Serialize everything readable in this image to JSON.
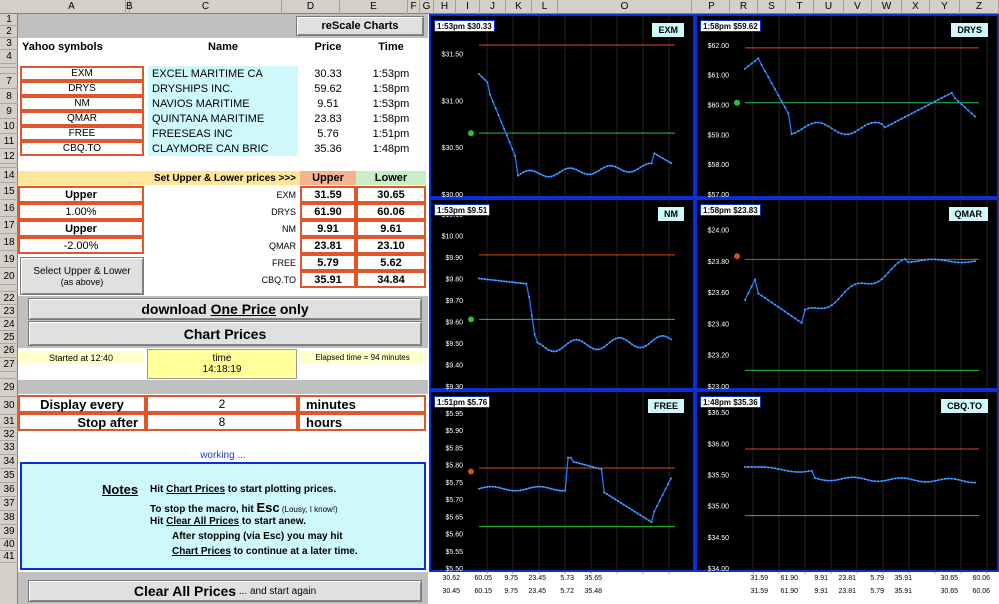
{
  "columns": [
    "A",
    "B",
    "C",
    "D",
    "E",
    "F",
    "G",
    "H",
    "I",
    "J",
    "K",
    "L",
    "O",
    "P",
    "R",
    "S",
    "T",
    "U",
    "V",
    "W",
    "X",
    "Y",
    "Z"
  ],
  "rows": [
    "1",
    "2",
    "3",
    "4",
    "5",
    "6",
    "7",
    "8",
    "9",
    "10",
    "11",
    "12",
    "13",
    "14",
    "15",
    "16",
    "17",
    "18",
    "19",
    "20",
    "21",
    "22",
    "23",
    "24",
    "25",
    "26",
    "27",
    "28",
    "29",
    "30",
    "31",
    "32",
    "33",
    "34",
    "35",
    "36",
    "37",
    "38",
    "39",
    "40",
    "41"
  ],
  "header": {
    "symbols": "Yahoo symbols",
    "name": "Name",
    "price": "Price",
    "time": "Time",
    "rescale": "reScale Charts"
  },
  "stocks": [
    {
      "sym": "EXM",
      "name": "EXCEL MARITIME CA",
      "price": "30.33",
      "time": "1:53pm"
    },
    {
      "sym": "DRYS",
      "name": "DRYSHIPS INC.",
      "price": "59.62",
      "time": "1:58pm"
    },
    {
      "sym": "NM",
      "name": "NAVIOS MARITIME",
      "price": "9.51",
      "time": "1:53pm"
    },
    {
      "sym": "QMAR",
      "name": "QUINTANA MARITIME",
      "price": "23.83",
      "time": "1:58pm"
    },
    {
      "sym": "FREE",
      "name": "FREESEAS INC",
      "price": "5.76",
      "time": "1:51pm"
    },
    {
      "sym": "CBQ.TO",
      "name": "CLAYMORE CAN BRIC",
      "price": "35.36",
      "time": "1:48pm"
    }
  ],
  "limits": {
    "title": "Set Upper & Lower prices >>>",
    "upper": "Upper",
    "lower": "Lower",
    "rows": [
      {
        "sym": "EXM",
        "upper": "31.59",
        "lower": "30.65"
      },
      {
        "sym": "DRYS",
        "upper": "61.90",
        "lower": "60.06"
      },
      {
        "sym": "NM",
        "upper": "9.91",
        "lower": "9.61"
      },
      {
        "sym": "QMAR",
        "upper": "23.81",
        "lower": "23.10"
      },
      {
        "sym": "FREE",
        "upper": "5.79",
        "lower": "5.62"
      },
      {
        "sym": "CBQ.TO",
        "upper": "35.91",
        "lower": "34.84"
      }
    ]
  },
  "side": {
    "upper1": "Upper",
    "pct1": "1.00%",
    "upper2": "Upper",
    "pct2": "-2.00%",
    "select": "Select Upper & Lower",
    "select_sub": "(as above)"
  },
  "buttons": {
    "download_a": "download ",
    "download_b": "One Price",
    "download_c": " only",
    "chart": "Chart Prices",
    "clear": "Clear All Prices",
    "clear_sub": " ... and start again"
  },
  "status": {
    "started": "Started at 12:40",
    "time_label": "time",
    "time_value": "14:18:19",
    "elapsed": "Elapsed time = 94 minutes",
    "working": "working ..."
  },
  "display": {
    "every_label": "Display every",
    "every_val": "2",
    "every_unit": "minutes",
    "stop_label": "Stop after",
    "stop_val": "8",
    "stop_unit": "hours"
  },
  "notes": {
    "title": "Notes",
    "l1a": "Hit ",
    "l1b": "Chart Prices",
    "l1c": " to start plotting prices.",
    "l2a": "To stop the macro, hit ",
    "l2b": "Esc",
    "l2c": " (Lousy, I know!)",
    "l3a": "Hit ",
    "l3b": "Clear All Prices",
    "l3c": " to start anew.",
    "l4": "After stopping (via Esc) you may hit",
    "l5a": "Chart Prices",
    "l5b": " to continue at a later time."
  },
  "charts": [
    {
      "id": "EXM",
      "label": "1:53pm $30.33",
      "ticks": [
        "$31.50",
        "$31.00",
        "$30.50",
        "$30.00"
      ],
      "upper": 31.59,
      "lower": 30.65,
      "ymin": 30.0,
      "ymax": 31.75
    },
    {
      "id": "DRYS",
      "label": "1:58pm $59.62",
      "ticks": [
        "$62.00",
        "$61.00",
        "$60.00",
        "$59.00",
        "$58.00",
        "$57.00"
      ],
      "upper": 61.9,
      "lower": 60.06,
      "ymin": 57.0,
      "ymax": 62.5
    },
    {
      "id": "NM",
      "label": "1:53pm $9.51",
      "ticks": [
        "$10.10",
        "$10.00",
        "$9.90",
        "$9.80",
        "$9.70",
        "$9.60",
        "$9.50",
        "$9.40",
        "$9.30"
      ],
      "upper": 9.91,
      "lower": 9.61,
      "ymin": 9.3,
      "ymax": 10.1
    },
    {
      "id": "QMAR",
      "label": "1:58pm $23.83",
      "ticks": [
        "$24.00",
        "$23.80",
        "$23.60",
        "$23.40",
        "$23.20",
        "$23.00"
      ],
      "upper": 23.81,
      "lower": 23.1,
      "ymin": 23.0,
      "ymax": 24.1
    },
    {
      "id": "FREE",
      "label": "1:51pm $5.76",
      "ticks": [
        "$5.95",
        "$5.90",
        "$5.85",
        "$5.80",
        "$5.75",
        "$5.70",
        "$5.65",
        "$5.60",
        "$5.55",
        "$5.50"
      ],
      "upper": 5.79,
      "lower": 5.62,
      "ymin": 5.5,
      "ymax": 5.97
    },
    {
      "id": "CBQ.TO",
      "label": "1:48pm $35.36",
      "ticks": [
        "$36.50",
        "$36.00",
        "$35.50",
        "$35.00",
        "$34.50",
        "$34.00"
      ],
      "upper": 35.91,
      "lower": 34.84,
      "ymin": 34.0,
      "ymax": 36.6
    }
  ],
  "bottom_rows": {
    "r40_left": [
      "30.62",
      "60.05",
      "9.75",
      "23.45",
      "5.73",
      "35.65"
    ],
    "r41_left": [
      "30.45",
      "60.15",
      "9.75",
      "23.45",
      "5.72",
      "35.48"
    ],
    "r40_right": [
      "31.59",
      "61.90",
      "9.91",
      "23.81",
      "5.79",
      "35.91",
      "30.65",
      "60.06"
    ],
    "r41_right": [
      "31.59",
      "61.90",
      "9.91",
      "23.81",
      "5.79",
      "35.91",
      "30.65",
      "60.06"
    ]
  },
  "colors": {
    "accent": "#e0562a",
    "cyan": "#cff8fa",
    "yellow": "#ffff99",
    "chart_border": "#0a2fd6",
    "series": "#1e7bff",
    "upper": "#d84a20",
    "lower": "#29c23a"
  }
}
